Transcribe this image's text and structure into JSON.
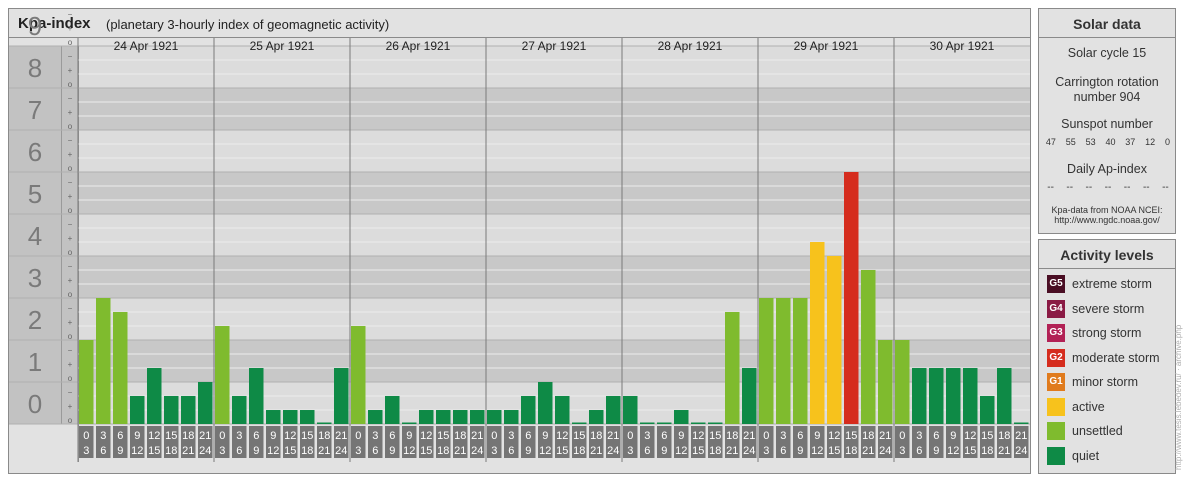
{
  "header": {
    "title": "Kpa-index",
    "subtitle": "(planetary 3-hourly index of geomagnetic activity)"
  },
  "chart_data": {
    "type": "bar",
    "ylim": [
      0,
      9
    ],
    "y_ticks": [
      "0",
      "1",
      "2",
      "3",
      "4",
      "5",
      "6",
      "7",
      "8",
      "9"
    ],
    "minor_tick_marks": [
      "o",
      "+",
      "−"
    ],
    "days": [
      "24 Apr 1921",
      "25 Apr 1921",
      "26 Apr 1921",
      "27 Apr 1921",
      "28 Apr 1921",
      "29 Apr 1921",
      "30 Apr 1921"
    ],
    "interval_labels": [
      [
        "0",
        "3"
      ],
      [
        "3",
        "6"
      ],
      [
        "6",
        "9"
      ],
      [
        "9",
        "12"
      ],
      [
        "12",
        "15"
      ],
      [
        "15",
        "18"
      ],
      [
        "18",
        "21"
      ],
      [
        "21",
        "24"
      ]
    ],
    "values": [
      [
        2.0,
        3.0,
        2.667,
        0.667,
        1.333,
        0.667,
        0.667,
        1.0
      ],
      [
        2.333,
        0.667,
        1.333,
        0.333,
        0.333,
        0.333,
        0.0,
        1.333
      ],
      [
        2.333,
        0.333,
        0.667,
        0.0,
        0.333,
        0.333,
        0.333,
        0.333
      ],
      [
        0.333,
        0.333,
        0.667,
        1.0,
        0.667,
        0.0,
        0.333,
        0.667
      ],
      [
        0.667,
        0.0,
        0.0,
        0.333,
        0.0,
        0.0,
        2.667,
        1.333
      ],
      [
        3.0,
        3.0,
        3.0,
        4.333,
        4.0,
        6.0,
        3.667,
        2.0
      ],
      [
        2.0,
        1.333,
        1.333,
        1.333,
        1.333,
        0.667,
        1.333,
        0.0
      ]
    ],
    "colors": {
      "quiet": "#0e8a46",
      "unsettled": "#7fbb2e",
      "active": "#f7c21c",
      "G1": "#e07b1d",
      "G2": "#d52c1d",
      "G3": "#b22155",
      "G4": "#8a1a44",
      "G5": "#4a0e24"
    }
  },
  "solar": {
    "title": "Solar data",
    "cycle": "Solar cycle 15",
    "carrington_line1": "Carrington rotation",
    "carrington_line2": "number 904",
    "sunspot_title": "Sunspot number",
    "sunspots": [
      "47",
      "55",
      "53",
      "40",
      "37",
      "12",
      "0"
    ],
    "ap_title": "Daily Ap-index",
    "ap_values": [
      "--",
      "--",
      "--",
      "--",
      "--",
      "--",
      "--"
    ],
    "source_line1": "Kpa-data from NOAA NCEI:",
    "source_line2": "http://www.ngdc.noaa.gov/"
  },
  "activity": {
    "title": "Activity levels",
    "levels": [
      {
        "code": "G5",
        "label": "extreme storm",
        "color": "#4a0e24"
      },
      {
        "code": "G4",
        "label": "severe storm",
        "color": "#8a1a44"
      },
      {
        "code": "G3",
        "label": "strong storm",
        "color": "#b22155"
      },
      {
        "code": "G2",
        "label": "moderate storm",
        "color": "#d52c1d"
      },
      {
        "code": "G1",
        "label": "minor storm",
        "color": "#e07b1d"
      },
      {
        "code": "",
        "label": "active",
        "color": "#f7c21c"
      },
      {
        "code": "",
        "label": "unsettled",
        "color": "#7fbb2e"
      },
      {
        "code": "",
        "label": "quiet",
        "color": "#0e8a46"
      }
    ]
  },
  "credit": "http://www.tesis.lebedev.ru/ · archive.php"
}
